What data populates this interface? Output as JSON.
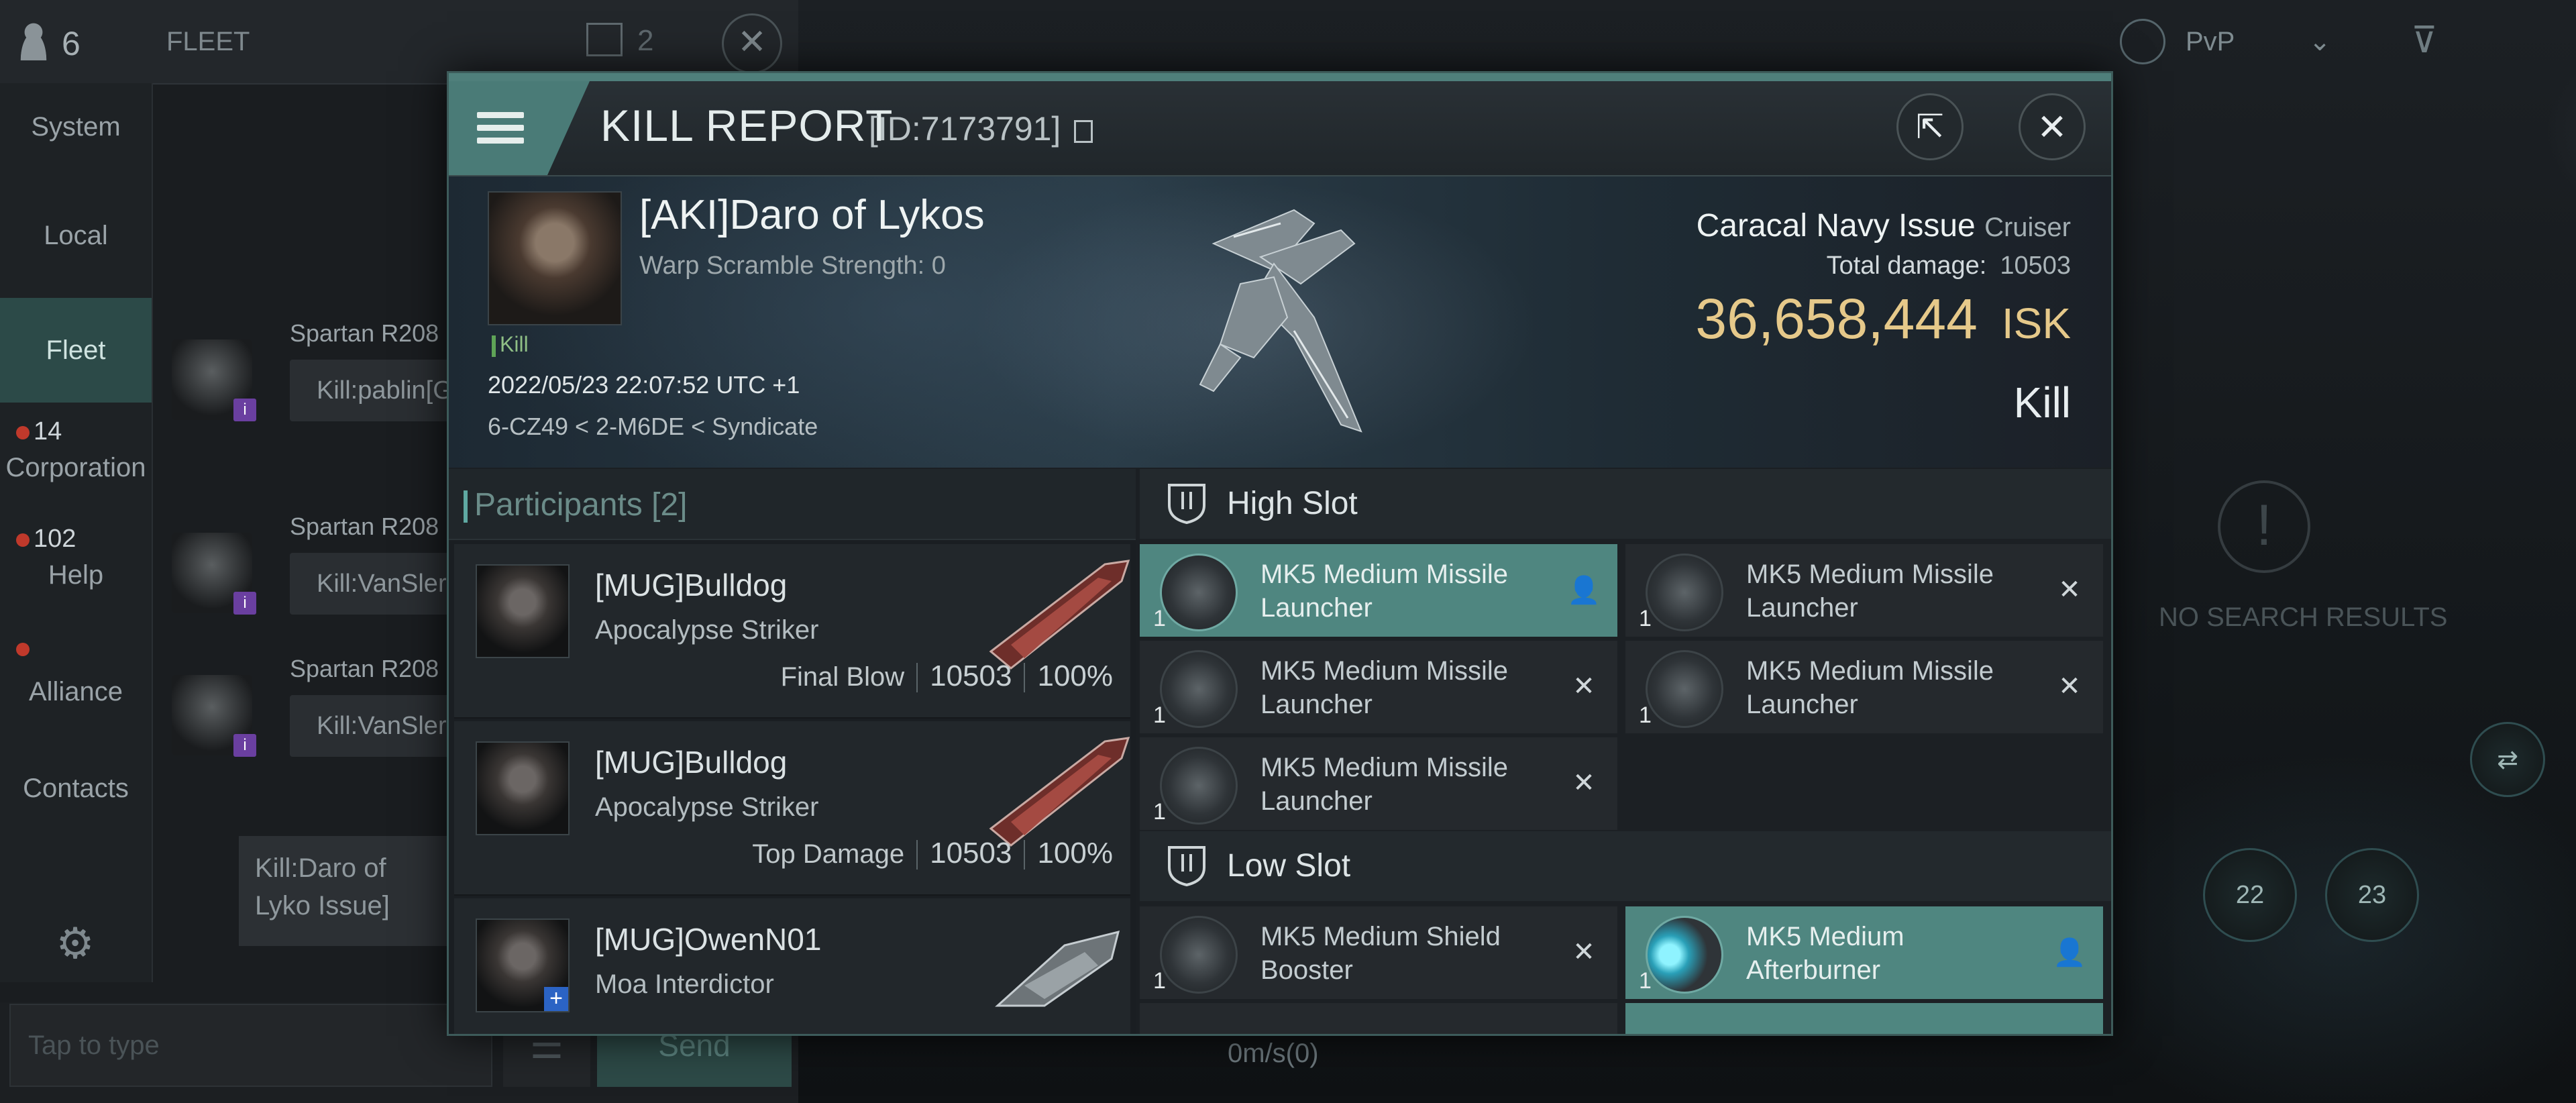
{
  "chat": {
    "online_count": "6",
    "channel": "FLEET",
    "unread_count": "2",
    "nav": [
      {
        "label": "System"
      },
      {
        "label": "Local"
      },
      {
        "label": "Fleet"
      },
      {
        "label": "Corporation",
        "badge": "14"
      },
      {
        "label": "Help",
        "badge": "102"
      },
      {
        "label": "Alliance"
      },
      {
        "label": "Contacts"
      }
    ],
    "messages": [
      {
        "sender": "Spartan R208",
        "text": "Kill:pablin[G"
      },
      {
        "sender": "Spartan R208",
        "text": "Kill:VanSler"
      },
      {
        "sender": "Spartan R208",
        "text": "Kill:VanSler"
      }
    ],
    "preview_text": "Kill:Daro of Lyko Issue]",
    "input_placeholder": "Tap to type",
    "send_label": "Send"
  },
  "hud": {
    "mode": "PvP",
    "no_results": "NO SEARCH RESULTS",
    "speed": "0m/s(0)",
    "slot_numbers": [
      "22",
      "23"
    ]
  },
  "kill_report": {
    "title": "KILL REPORT",
    "id": "[ID:7173791]",
    "victim": {
      "name": "[AKI]Daro of Lykos",
      "warp_scramble": "Warp Scramble Strength: 0",
      "tag": "Kill",
      "datetime": "2022/05/23 22:07:52 UTC +1",
      "location": "6-CZ49 < 2-M6DE < Syndicate"
    },
    "ship": {
      "name": "Caracal Navy Issue",
      "class": "Cruiser",
      "total_damage_label": "Total damage:",
      "total_damage": "10503",
      "isk_value": "36,658,444",
      "currency": "ISK",
      "result": "Kill"
    },
    "participants": {
      "label": "Participants",
      "count": "[2]",
      "items": [
        {
          "name": "[MUG]Bulldog",
          "ship": "Apocalypse Striker",
          "label": "Final Blow",
          "damage": "10503",
          "percent": "100%"
        },
        {
          "name": "[MUG]Bulldog",
          "ship": "Apocalypse Striker",
          "label": "Top Damage",
          "damage": "10503",
          "percent": "100%"
        },
        {
          "name": "[MUG]OwenN01",
          "ship": "Moa Interdictor"
        }
      ]
    },
    "high_slot": {
      "title": "High Slot",
      "modules": [
        {
          "name": "MK5 Medium Missile Launcher",
          "qty": "1",
          "status": "dropped"
        },
        {
          "name": "MK5 Medium Missile Launcher",
          "qty": "1",
          "status": "destroyed"
        },
        {
          "name": "MK5 Medium Missile Launcher",
          "qty": "1",
          "status": "destroyed"
        },
        {
          "name": "MK5 Medium Missile Launcher",
          "qty": "1",
          "status": "destroyed"
        },
        {
          "name": "MK5 Medium Missile Launcher",
          "qty": "1",
          "status": "destroyed"
        }
      ]
    },
    "low_slot": {
      "title": "Low Slot",
      "modules": [
        {
          "name": "MK5 Medium Shield Booster",
          "qty": "1",
          "status": "destroyed"
        },
        {
          "name": "MK5 Medium Afterburner",
          "qty": "1",
          "status": "dropped"
        }
      ]
    }
  },
  "colors": {
    "accent": "#4f8680",
    "isk": "#e6c98a",
    "modal_border": "#3d5b5a"
  }
}
